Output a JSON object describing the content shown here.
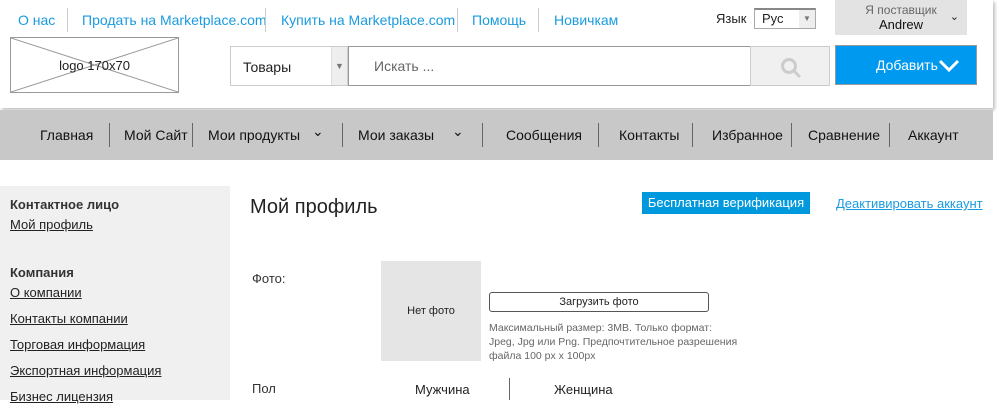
{
  "top_links": [
    "О нас",
    "Продать на Marketplace.com",
    "Купить на Marketplace.com",
    "Помощь",
    "Новичкам"
  ],
  "language": {
    "label": "Язык",
    "value": "Рус"
  },
  "account": {
    "role": "Я поставщик",
    "name": "Andrew"
  },
  "logo": "logo 170x70",
  "search": {
    "category": "Товары",
    "placeholder": "Искать ..."
  },
  "add_button": "Добавить",
  "nav": [
    "Главная",
    "Мой Сайт",
    "Мои продукты",
    "Мои заказы",
    "Сообщения",
    "Контакты",
    "Избранное",
    "Сравнение",
    "Аккаунт"
  ],
  "sidebar": {
    "contact_heading": "Контактное лицо",
    "contact_items": [
      "Мой профиль"
    ],
    "company_heading": "Компания",
    "company_items": [
      "О компании",
      "Контакты компании",
      "Торговая информация",
      "Экспортная информация",
      "Бизнес лицензия"
    ]
  },
  "main": {
    "title": "Мой профиль",
    "verify_button": "Бесплатная верификация",
    "deactivate_link": "Деактивировать аккаунт",
    "photo_label": "Фото:",
    "no_photo": "Нет фото",
    "upload_button": "Загрузить фото",
    "upload_hint": "Максимальный размер: 3MB. Только формат: Jpeg, Jpg или Png. Предпочтительное разрешения файла 100 px x 100px",
    "gender_label": "Пол",
    "gender_options": [
      "Мужчина",
      "Женщина"
    ]
  },
  "colors": {
    "link": "#1a9be0",
    "accent": "#0099f0",
    "nav_bg": "#c8c8c8",
    "sidebar_bg": "#f0f0f0"
  }
}
